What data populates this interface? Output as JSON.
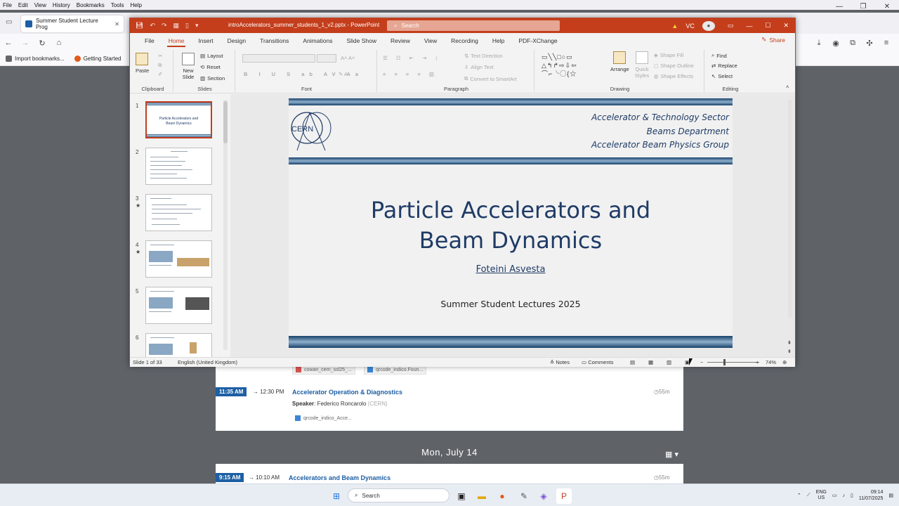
{
  "browser": {
    "menu": [
      "File",
      "Edit",
      "View",
      "History",
      "Bookmarks",
      "Tools",
      "Help"
    ],
    "tab_title": "Summer Student Lecture Prog",
    "bookmarks": [
      "Import bookmarks...",
      "Getting Started"
    ]
  },
  "indico": {
    "attachments_top": [
      "cowan_cern_ssl25_...",
      "qrcode_indico.Foun..."
    ],
    "talk1": {
      "start": "11:35 AM",
      "end": "→ 12:30 PM",
      "title": "Accelerator Operation & Diagnostics",
      "duration": "55m",
      "speaker_label": "Speaker",
      "speaker": ": Federico Roncarolo",
      "speaker_org": "(CERN)",
      "attachment": "qrcode_indico_Acce..."
    },
    "day_header": "Mon, July 14",
    "talk2": {
      "start": "9:15 AM",
      "end": "→ 10:10 AM",
      "title": "Accelerators and Beam Dynamics",
      "duration": "55m"
    }
  },
  "taskbar": {
    "search_placeholder": "Search",
    "lang_top": "ENG",
    "lang_bottom": "US",
    "time": "09:14",
    "date": "11/07/2025"
  },
  "ppt": {
    "filename": "introAccelerators_summer_students_1_v2.pptx  -  PowerPoint",
    "search_placeholder": "Search",
    "user_initials": "VC",
    "tabs": [
      "File",
      "Home",
      "Insert",
      "Design",
      "Transitions",
      "Animations",
      "Slide Show",
      "Review",
      "View",
      "Recording",
      "Help",
      "PDF-XChange"
    ],
    "active_tab": "Home",
    "share": "Share",
    "ribbon": {
      "paste": "Paste",
      "new_slide": "New Slide",
      "layout": "Layout",
      "reset": "Reset",
      "section": "Section",
      "text_direction": "Text Direction",
      "align_text": "Align Text",
      "convert_smartart": "Convert to SmartArt",
      "arrange": "Arrange",
      "quick_styles": "Quick Styles",
      "shape_fill": "Shape Fill",
      "shape_outline": "Shape Outline",
      "shape_effects": "Shape Effects",
      "find": "Find",
      "replace": "Replace",
      "select": "Select",
      "groups": [
        "Clipboard",
        "Slides",
        "Font",
        "Paragraph",
        "Drawing",
        "Editing"
      ]
    },
    "thumb_numbers": [
      "1",
      "2",
      "3",
      "4",
      "5",
      "6"
    ],
    "thumb1_title": "Particle Accelerators and Beam Dynamics",
    "slide": {
      "header_lines": [
        "Accelerator & Technology Sector",
        "Beams Department",
        "Accelerator Beam Physics Group"
      ],
      "logo_text": "CERN",
      "title_line1": "Particle Accelerators and",
      "title_line2": "Beam Dynamics",
      "author": "Foteini Asvesta",
      "event": "Summer Student Lectures 2025"
    },
    "status": {
      "slide_of": "Slide 1 of 33",
      "language": "English (United Kingdom)",
      "notes": "Notes",
      "comments": "Comments",
      "zoom": "74%"
    }
  }
}
